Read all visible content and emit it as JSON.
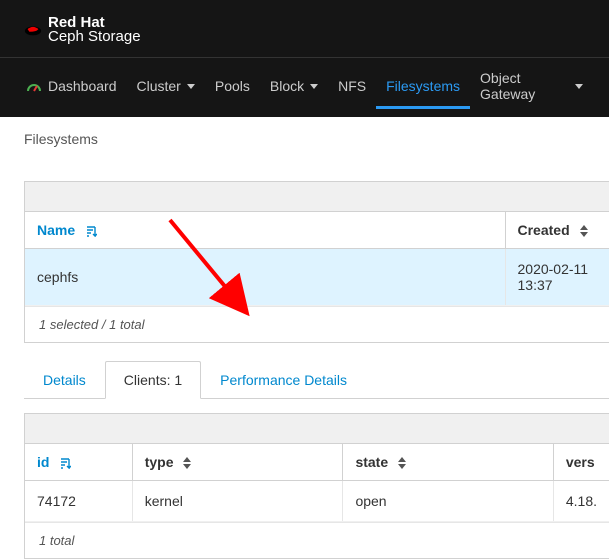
{
  "brand": {
    "line1": "Red Hat",
    "line2": "Ceph Storage"
  },
  "nav": {
    "dashboard": "Dashboard",
    "cluster": "Cluster",
    "pools": "Pools",
    "block": "Block",
    "nfs": "NFS",
    "filesystems": "Filesystems",
    "object_gateway": "Object Gateway"
  },
  "breadcrumb": "Filesystems",
  "fs_table": {
    "cols": {
      "name": "Name",
      "created": "Created"
    },
    "row": {
      "name": "cephfs",
      "created": "2020-02-11 13:37"
    },
    "footer": "1 selected / 1 total"
  },
  "tabs": {
    "details": "Details",
    "clients": "Clients: 1",
    "perf": "Performance Details"
  },
  "clients_table": {
    "cols": {
      "id": "id",
      "type": "type",
      "state": "state",
      "vers": "vers"
    },
    "row": {
      "id": "74172",
      "type": "kernel",
      "state": "open",
      "vers": "4.18."
    },
    "footer": "1 total"
  }
}
